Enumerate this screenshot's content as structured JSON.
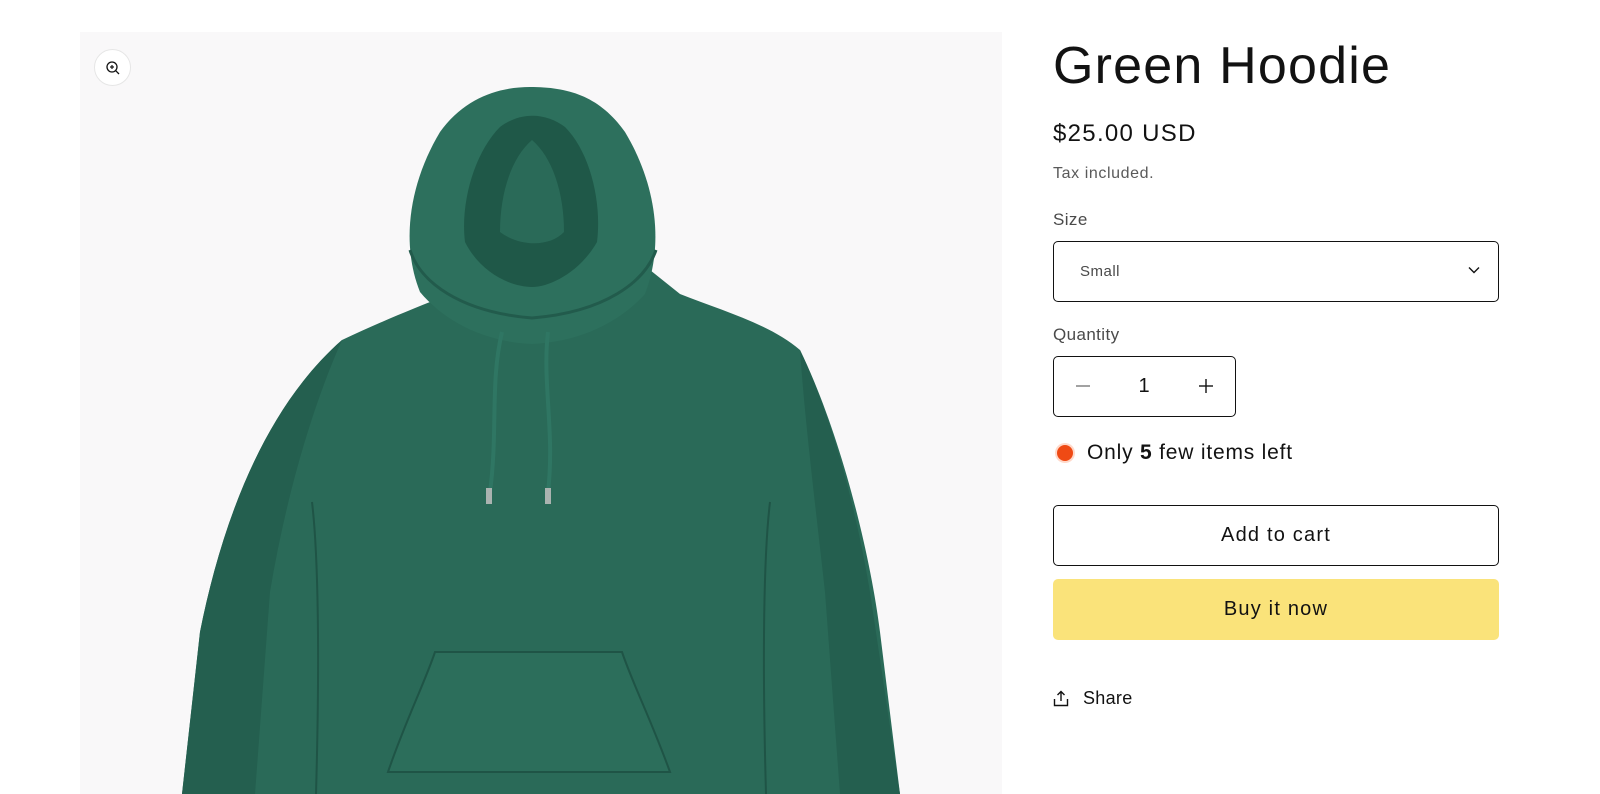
{
  "product": {
    "title": "Green Hoodie",
    "price": "$25.00 USD",
    "tax_note": "Tax included.",
    "image_icon": "zoom-in-icon",
    "product_color": "#2a6a58"
  },
  "size": {
    "label": "Size",
    "selected": "Small",
    "icon": "chevron-down-icon"
  },
  "quantity": {
    "label": "Quantity",
    "value": "1",
    "decrease_icon": "minus-icon",
    "increase_icon": "plus-icon"
  },
  "stock": {
    "prefix": "Only",
    "count": "5",
    "suffix": "few items left",
    "indicator_color": "#ef4a14"
  },
  "actions": {
    "add_to_cart": "Add to cart",
    "buy_now": "Buy it now",
    "buy_now_color": "#fae37a",
    "share": "Share",
    "share_icon": "share-icon"
  }
}
